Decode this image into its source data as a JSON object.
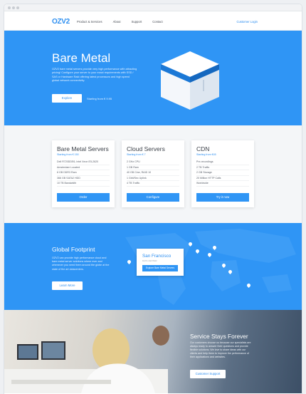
{
  "nav": {
    "logo": "OZV2",
    "links": [
      "Product & Services",
      "About",
      "Support",
      "Contact"
    ],
    "right_link": "Customer Login"
  },
  "hero": {
    "title": "Bare Metal",
    "description": "OZV2 bare metal servers provide very high performance with attracting pricing! Configure your server to your exact requirements with SSD / SAS or Hardware Raid offering latest processors and high speed global network connectivity.",
    "button": "Explore",
    "note": "Starting from € 9.95"
  },
  "plans": [
    {
      "name": "Bare Metal Servers",
      "price": "Starting from € 150",
      "features": [
        "Dell R720DDE6, Intel Xeon E5-2620",
        "Amsterdam Located",
        "8 GB DDR3 Ram",
        "366 GB SATA2 HDD",
        "10 TB Bandwidth"
      ],
      "button": "Order"
    },
    {
      "name": "Cloud Servers",
      "price": "Starting from € 7",
      "features": [
        "2 GHz CPU",
        "1 GB Ram",
        "40 GB Cine, RAID 10",
        "1 Gbit/Sec Uplink",
        "4 TB Traffic"
      ],
      "button": "Configure"
    },
    {
      "name": "CDN",
      "price": "Starting from €45",
      "features": [
        "Pre-recordings",
        "2 TB Traffic",
        "2 GB Storage",
        "20 Million HTTP Calls",
        "Worldwide"
      ],
      "button": "Try it now"
    }
  ],
  "globe": {
    "title": "Global Footprint",
    "description": "OZV2 can provide high performance cloud and bare metal server solutions where ever and whenever you need them around the globe at the state of the art datacenters.",
    "button": "Learn More",
    "popup": {
      "city": "San Francisco",
      "subtitle": "DATA CENTER",
      "button": "Explore Bare Metal Servers"
    }
  },
  "support": {
    "title": "Service Stays Forever",
    "description": "Our customers choose us because our specialists are always ready to answer their questions and provide flexible solutions. We love to share ideas with our clients and help them to improve the performance of their applications and websites.",
    "button": "Customer Support"
  },
  "colors": {
    "brand": "#2f95f5",
    "text": "#3b4048"
  },
  "icons": [
    "map-pin-icon"
  ]
}
